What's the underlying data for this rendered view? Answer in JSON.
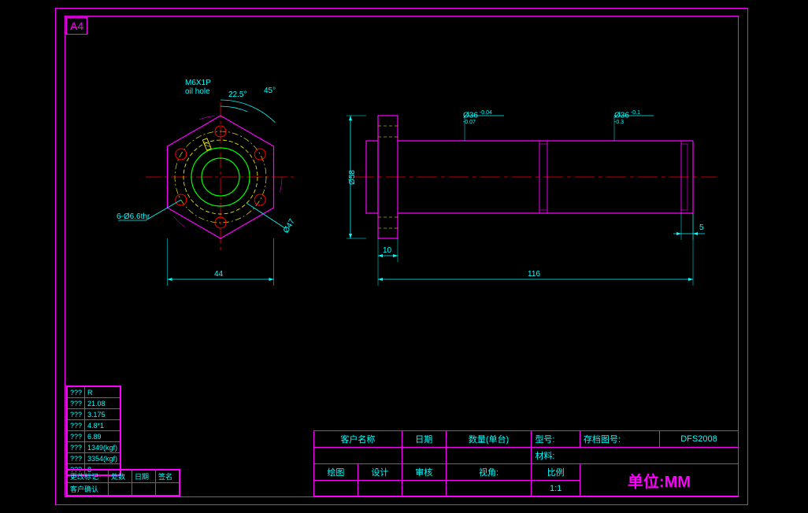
{
  "frame": {
    "a4": "A4"
  },
  "annot": {
    "thread": "M6X1P",
    "oilhole": "oil hole",
    "angle1": "22.5°",
    "angle2": "45°",
    "holes": "6-Ø6.6thr",
    "d58": "Ø58",
    "d47": "Ø47",
    "d36a": "Ø36",
    "d36a_tol1": "-0.04",
    "d36a_tol2": "-0.07",
    "d36b": "Ø36",
    "d36b_tol1": "-0.1",
    "d36b_tol2": "-0.3",
    "len44": "44",
    "len10": "10",
    "len116": "116",
    "len5": "5"
  },
  "proptable": {
    "r1c1": "???",
    "r1c2": "R",
    "r2c1": "???",
    "r2c2": "21.08",
    "r3c1": "???",
    "r3c2": "3.175",
    "r4c1": "???",
    "r4c2": "4.8*1",
    "r5c1": "???",
    "r5c2": "6.89",
    "r6c1": "???",
    "r6c2": "1349(kgf)",
    "r7c1": "???",
    "r7c2": "3354(kgf)",
    "r8c1": "???",
    "r8c2": "8"
  },
  "revtable": {
    "h1": "更改标记",
    "h2": "处数",
    "h3": "日期",
    "h4": "签名",
    "h5": "客户确认"
  },
  "titleblock": {
    "r1": {
      "customer": "客户名称",
      "date": "日期",
      "qty": "数量(单台)",
      "model": "型号:",
      "drawno_label": "存档图号:",
      "drawno": "DFS2008"
    },
    "r2": {
      "material": "材料:"
    },
    "r3": {
      "draw": "绘图",
      "design": "设计",
      "check": "审核",
      "view": "视角:",
      "scale": "比例",
      "scaleval": "1:1",
      "unit": "单位:MM"
    }
  }
}
